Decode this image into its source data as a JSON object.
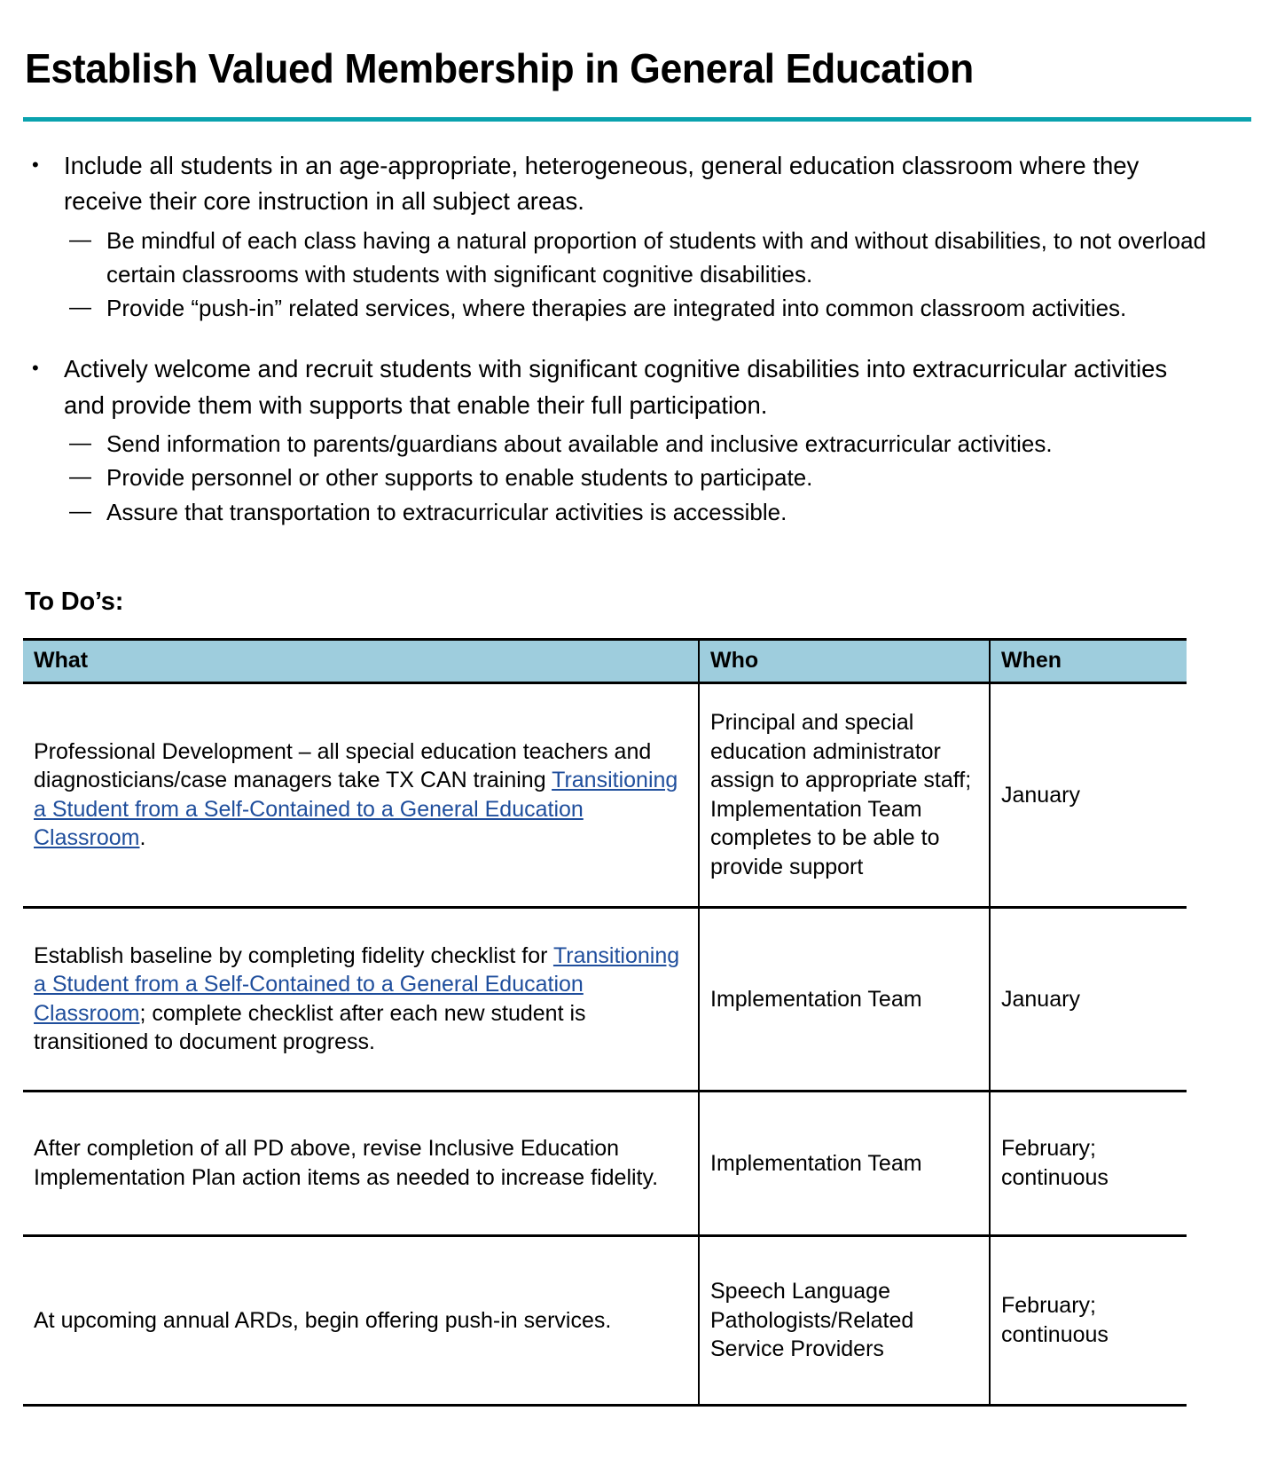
{
  "document": {
    "title": "Establish Valued Membership in General Education",
    "accent_color": "#0aa2ae",
    "link_color": "#1f4e9c",
    "table_header_color": "#9ecddd"
  },
  "bullets": [
    {
      "text": "Include all students in an age-appropriate, heterogeneous, general education classroom where they receive their core instruction in all subject areas.",
      "marker": "•",
      "subitems": [
        {
          "marker": "—",
          "text": "Be mindful of each class having a natural proportion of students with and without disabilities, to not overload certain classrooms with students with significant cognitive disabilities."
        },
        {
          "marker": "—",
          "text": "Provide “push-in” related services, where therapies are integrated into common classroom activities."
        }
      ]
    },
    {
      "text": "Actively welcome and recruit students with significant cognitive disabilities into extracurricular activities and provide them with supports that enable their full participation.",
      "marker": "•",
      "subitems": [
        {
          "marker": "—",
          "text": "Send information to parents/guardians about available and inclusive extracurricular activities."
        },
        {
          "marker": "—",
          "text": "Provide personnel or other supports to enable students to participate."
        },
        {
          "marker": "—",
          "text": "Assure that transportation to extracurricular activities is accessible."
        }
      ]
    }
  ],
  "todo": {
    "heading": "To Do’s:",
    "columns": [
      "What",
      "Who",
      "When"
    ],
    "rows": [
      {
        "what_pre": "Professional Development – all special education teachers and diagnosticians/case managers take TX CAN training ",
        "what_link": "Transitioning a Student from a Self-Contained to a General Education Classroom",
        "what_post": ".",
        "who": "Principal and special education administrator assign to appropriate staff; Implementation Team completes to be able to provide support",
        "when": "January"
      },
      {
        "what_pre": "Establish baseline by completing fidelity checklist for ",
        "what_link": "Transitioning a Student from a Self-Contained to a General Education Classroom",
        "what_post": "; complete checklist after each new student is transitioned to document progress.",
        "who": "Implementation Team",
        "when": "January"
      },
      {
        "what_pre": "After completion of all PD above, revise Inclusive Education Implementation Plan action items as needed to increase fidelity.",
        "what_link": "",
        "what_post": "",
        "who": "Implementation Team",
        "when": "February; continuous"
      },
      {
        "what_pre": "At upcoming annual ARDs, begin offering push-in services.",
        "what_link": "",
        "what_post": "",
        "who": "Speech Language Pathologists/Related Service Providers",
        "when": "February; continuous"
      }
    ]
  }
}
